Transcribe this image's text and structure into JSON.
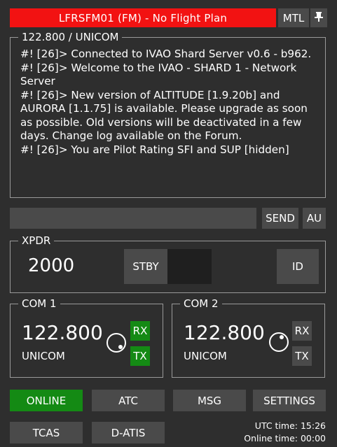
{
  "header": {
    "callsign_status": "LFRSFM01 (FM) - No Flight Plan",
    "mtl_label": "MTL",
    "pin_icon": "pin-icon"
  },
  "messages": {
    "legend": "122.800 / UNICOM",
    "lines": [
      "#! [26]> Connected to IVAO Shard Server v0.6 - b962.",
      "#! [26]> Welcome to the IVAO - SHARD 1 - Network Server",
      "#! [26]> New version of ALTITUDE [1.9.20b] and AURORA [1.1.75] is available. Please upgrade as soon as possible. Old versions will be deactivated in a few days. Change log available on the Forum.",
      "#! [26]> You are Pilot Rating SFI and SUP [hidden]"
    ]
  },
  "chat": {
    "input_value": "",
    "send_label": "SEND",
    "au_label": "AU"
  },
  "xpdr": {
    "legend": "XPDR",
    "code": "2000",
    "stby_label": "STBY",
    "id_label": "ID"
  },
  "com1": {
    "legend": "COM 1",
    "frequency": "122.800",
    "station": "UNICOM",
    "rx_label": "RX",
    "tx_label": "TX",
    "rx_active": true,
    "tx_active": true
  },
  "com2": {
    "legend": "COM 2",
    "frequency": "122.800",
    "station": "UNICOM",
    "rx_label": "RX",
    "tx_label": "TX",
    "rx_active": false,
    "tx_active": false
  },
  "nav": {
    "online": "ONLINE",
    "atc": "ATC",
    "msg": "MSG",
    "settings": "SETTINGS",
    "tcas": "TCAS",
    "datis": "D-ATIS"
  },
  "status": {
    "utc_time": "UTC time: 15:26",
    "online_time": "Online time: 00:00"
  },
  "colors": {
    "title_bar": "#f21212",
    "active_green": "#148a14",
    "button_gray": "#4a4a4a",
    "background": "#2e2e2e"
  }
}
